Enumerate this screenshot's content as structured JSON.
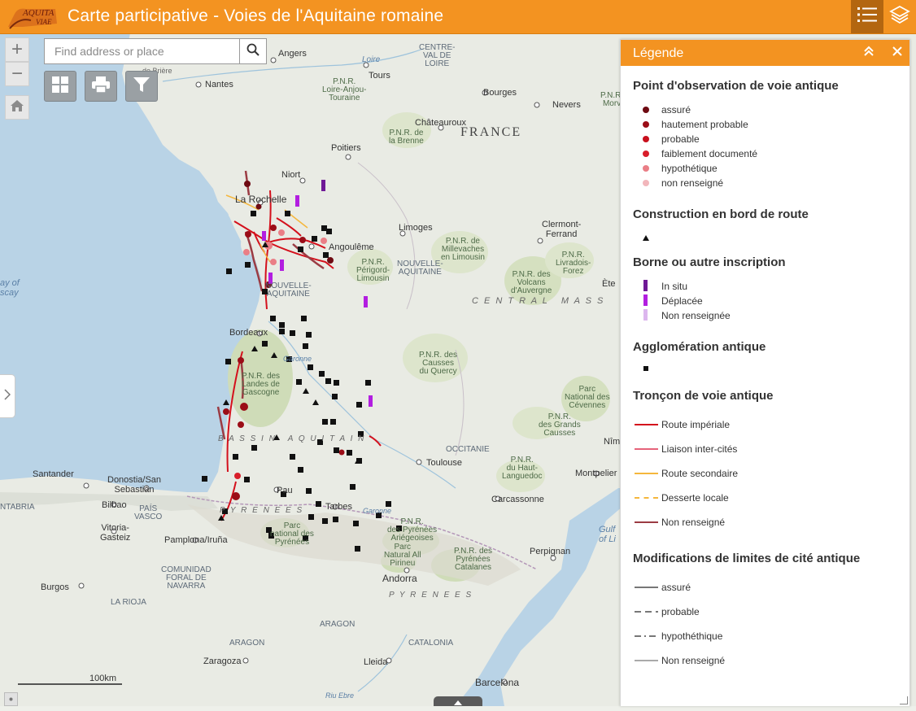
{
  "header": {
    "logo_text_line1": "AQUITA",
    "logo_text_line2": "VIAE",
    "title": "Carte participative - Voies de l'Aquitaine romaine"
  },
  "search": {
    "placeholder": "Find address or place"
  },
  "map": {
    "scale_label": "100km",
    "labels": {
      "angers": "Angers",
      "nantes": "Nantes",
      "tours": "Tours",
      "bourges": "Bourges",
      "nevers": "Nevers",
      "chateauroux": "Châteauroux",
      "poitiers": "Poitiers",
      "niort": "Niort",
      "la_rochelle": "La Rochelle",
      "limoges": "Limoges",
      "clermont": "Clermont-\nFerrand",
      "angouleme": "Angoulême",
      "bordeaux": "Bordeaux",
      "toulouse": "Toulouse",
      "carcassonne": "Carcassonne",
      "montpellier": "Montpelier",
      "perpignan": "Perpignan",
      "pau": "Pau",
      "tarbes": "Tarbes",
      "andorra": "Andorra",
      "barcelona": "Barcelona",
      "lleida": "Lleida",
      "zaragoza": "Zaragoza",
      "burgos": "Burgos",
      "bilbao": "Bilbao",
      "santander": "Santander",
      "donostia": "Donostia/San\nSebastián",
      "vitoria": "Vitoria-\nGasteiz",
      "pamplona": "Pamplona/Iruña",
      "nime": "Nîm",
      "ete": "Ète",
      "france": "FRANCE",
      "centre": "CENTRE-\nVAL DE\nLOIRE",
      "nouvelle1": "NOUVELLE-\nAQUITAINE",
      "nouvelle2": "NOUVELLE-\nAQUITAINE",
      "occitanie": "OCCITANIE",
      "pais_vasco": "PAÍS\nVASCO",
      "navarra": "COMUNIDAD\nFORAL DE\nNAVARRA",
      "la_rioja": "LA RIOJA",
      "aragon1": "ARAGON",
      "aragon2": "ARAGON",
      "catalonia": "CATALONIA",
      "cantabria": "NTABRIA",
      "central": "C E N T R A L   M A S S",
      "pyrenees1": "P Y R E N E E S",
      "pyrenees2": "P Y R E N E E S",
      "bassin": "B A S S I N   A Q U I T A I N",
      "bay": "ay of\nscay",
      "golfe": "Gulf\nof Li",
      "loire": "Loire",
      "garonne": "Garonne",
      "riu_ebre": "Riu Ebre",
      "brie": "de Brière",
      "pnr_loire": "P.N.R.\nLoire-Anjou-\nTouraine",
      "pnr_brenne": "P.N.R. de\nla Brenne",
      "pnr_millevaches": "P.N.R. de\nMillevaches\nen Limousin",
      "pnr_perigord": "P.N.R.\nPérigord-\nLimousin",
      "pnr_volcans": "P.N.R. des\nVolcans\nd'Auvergne",
      "pnr_livradois": "P.N.R.\nLivradois-\nForez",
      "pnr_quercy": "P.N.R. des\nCausses\ndu Quercy",
      "pnr_landes": "P.N.R. des\nLandes de\nGascogne",
      "pnr_cevennes": "Parc\nNational des\nCévennes",
      "pnr_grands_causses": "P.N.R.\ndes Grands\nCausses",
      "pnr_haut_languedoc": "P.N.R.\ndu Haut-\nLanguedoc",
      "pnr_pyrenees_ariegeoises": "P.N.R.\ndes Pyrénées\nAriégeoises",
      "pnr_pyrenees_catalanes": "P.N.R. des\nPyrénées\nCatalanes",
      "pnr_natural": "Parc\nNatural All\nPirineu",
      "parc_pyrenees": "Parc\nnational des\nPyrénées",
      "pnr_morvan": "P.N.R.\nMorv"
    }
  },
  "legend": {
    "title": "Légende",
    "sections": [
      {
        "title": "Point d'observation de voie antique",
        "items": [
          {
            "label": "assuré",
            "color": "#6e0a12"
          },
          {
            "label": "hautement probable",
            "color": "#9b0d17"
          },
          {
            "label": "probable",
            "color": "#c8101d"
          },
          {
            "label": "faiblement documenté",
            "color": "#d81e2a"
          },
          {
            "label": "hypothétique",
            "color": "#ea7e86"
          },
          {
            "label": "non renseigné",
            "color": "#f2b6bb"
          }
        ]
      },
      {
        "title": "Construction en bord de route",
        "items": [
          {
            "label": "",
            "symbol": "triangle"
          }
        ]
      },
      {
        "title": "Borne ou autre inscription",
        "items": [
          {
            "label": "In situ",
            "color": "#6f1996"
          },
          {
            "label": "Déplacée",
            "color": "#b21ee0"
          },
          {
            "label": "Non renseignée",
            "color": "#dcb6ee"
          }
        ]
      },
      {
        "title": "Agglomération antique",
        "items": [
          {
            "label": "",
            "symbol": "square"
          }
        ]
      },
      {
        "title": "Tronçon de voie antique",
        "items": [
          {
            "label": "Route impériale",
            "color": "#d4101c",
            "style": "solid"
          },
          {
            "label": "Liaison inter-cités",
            "color": "#e6637a",
            "style": "solid"
          },
          {
            "label": "Route secondaire",
            "color": "#f5b73d",
            "style": "solid"
          },
          {
            "label": "Desserte locale",
            "color": "#f5b73d",
            "style": "dashed"
          },
          {
            "label": "Non renseigné",
            "color": "#9b3b43",
            "style": "solid"
          }
        ]
      },
      {
        "title": "Modifications de limites de cité antique",
        "items": [
          {
            "label": "assuré",
            "color": "#777777",
            "style": "solid"
          },
          {
            "label": "probable",
            "color": "#777777",
            "style": "dashed"
          },
          {
            "label": "hypothéthique",
            "color": "#777777",
            "style": "dashdot"
          },
          {
            "label": "Non renseigné",
            "color": "#aaaaaa",
            "style": "solid"
          }
        ]
      }
    ]
  }
}
